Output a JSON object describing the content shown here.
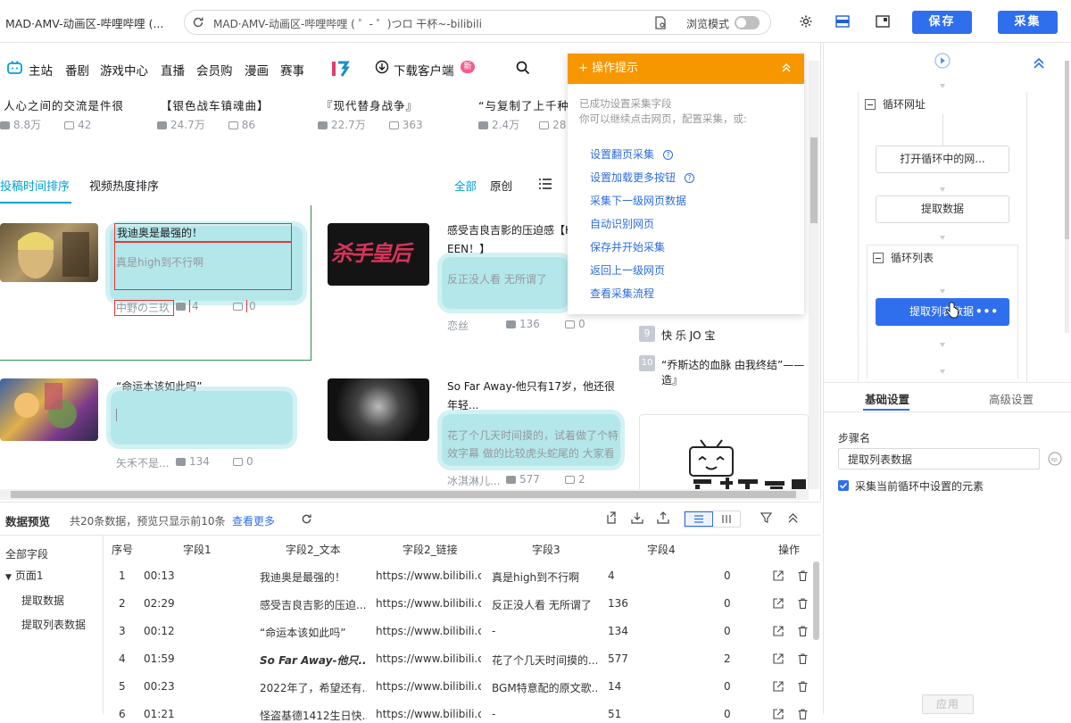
{
  "tab_title": "MAD·AMV-动画区-哔哩哔哩 (...",
  "url": "MAD·AMV-动画区-哔哩哔哩 ( ゜- ゜)つロ 干杯~-bilibili",
  "browse_mode_label": "浏览模式",
  "save_label": "保存",
  "collect_label": "采集",
  "nav": {
    "main_station": "主站",
    "items": [
      "番剧",
      "游戏中心",
      "直播",
      "会员购",
      "漫画",
      "赛事"
    ],
    "download": "下载客户端",
    "badge": "新"
  },
  "top_videos": [
    {
      "title": "人心之间的交流是件很",
      "play": "8.8万",
      "danmu": "42"
    },
    {
      "title": "【银色战车镇魂曲】",
      "play": "24.7万",
      "danmu": "86"
    },
    {
      "title": "『现代替身战争』",
      "play": "22.7万",
      "danmu": "363"
    },
    {
      "title": "“与复制了上千种生",
      "play": "2.4万",
      "danmu": "28"
    }
  ],
  "sort": {
    "by_time": "投稿时间排序",
    "by_hot": "视频热度排序",
    "all": "全部",
    "original": "原创"
  },
  "cards": [
    {
      "title": "我迪奥是最强的！",
      "sub": "真是high到不行啊",
      "author": "中野の三玖",
      "play": "4",
      "danmu": "0"
    },
    {
      "title": "感受吉良吉影的压迫感【K",
      "title2": "EEN！】",
      "sub": "反正没人看 无所谓了",
      "author": "恋丝",
      "play": "136",
      "danmu": "0"
    },
    {
      "title": "“命运本该如此吗”",
      "sub": "",
      "author": "矢禾不是...",
      "play": "134",
      "danmu": "0"
    },
    {
      "title": "So Far Away-他只有17岁，他还很",
      "title2": "年轻...",
      "sub": "花了个几天时间摸的，试着做了个特",
      "sub2": "效字幕 做的比较虎头蛇尾的 大家看",
      "author": "冰淇淋儿...",
      "play": "577",
      "danmu": "2"
    }
  ],
  "thumb_texts": {
    "card2": "杀手皇后"
  },
  "ranking": [
    {
      "rank": "9",
      "title": "快 乐 JO 宝"
    },
    {
      "rank": "10",
      "title": "“乔斯达的血脉 由我终结”——",
      "title2": "造』"
    }
  ],
  "popup": {
    "title": "操作提示",
    "desc1": "已成功设置采集字段",
    "desc2": "你可以继续点击网页，配置采集，或:",
    "links": [
      "设置翻页采集",
      "设置加载更多按钮",
      "采集下一级网页数据",
      "自动识别网页",
      "保存并开始采集",
      "返回上一级网页",
      "查看采集流程"
    ]
  },
  "flow": {
    "loop_url": "循环网址",
    "open_page": "打开循环中的网...",
    "extract": "提取数据",
    "loop_list": "循环列表",
    "extract_list": "提取列表数据"
  },
  "settings": {
    "tab_basic": "基础设置",
    "tab_advanced": "高级设置",
    "step_name_label": "步骤名",
    "step_name_value": "提取列表数据",
    "checkbox_label": "采集当前循环中设置的元素",
    "apply": "应用"
  },
  "preview": {
    "title": "数据预览",
    "summary": "共20条数据，预览只显示前10条",
    "more": "查看更多",
    "tree": {
      "all": "全部字段",
      "page": "页面1",
      "extract": "提取数据",
      "extract_list": "提取列表数据"
    },
    "headers": [
      "序号",
      "字段1",
      "字段2_文本",
      "字段2_链接",
      "字段3",
      "字段4",
      "操作"
    ],
    "rows": [
      [
        "1",
        "00:13",
        "我迪奥是最强的！",
        "https://www.bilibili.c...",
        "真是high到不行啊",
        "4",
        "0"
      ],
      [
        "2",
        "02:29",
        "感受吉良吉影的压迫...",
        "https://www.bilibili.c...",
        "反正没人看 无所谓了",
        "136",
        "0"
      ],
      [
        "3",
        "00:12",
        "“命运本该如此吗”",
        "https://www.bilibili.c...",
        "-",
        "134",
        "0"
      ],
      [
        "4",
        "01:59",
        "So Far Away-他只...",
        "https://www.bilibili.c...",
        "花了个几天时间摸的...",
        "577",
        "2"
      ],
      [
        "5",
        "00:23",
        "2022年了，希望还有...",
        "https://www.bilibili.c...",
        "BGM特意配的原文歌...",
        "14",
        "0"
      ],
      [
        "6",
        "01:21",
        "怪盗基德1412生日快...",
        "https://www.bilibili.c...",
        "-",
        "51",
        "0"
      ]
    ]
  },
  "colors": {
    "accent": "#2f6fee",
    "popup": "#f79700",
    "highlight": "#9bdfe3",
    "bili_blue": "#00a1d6"
  }
}
